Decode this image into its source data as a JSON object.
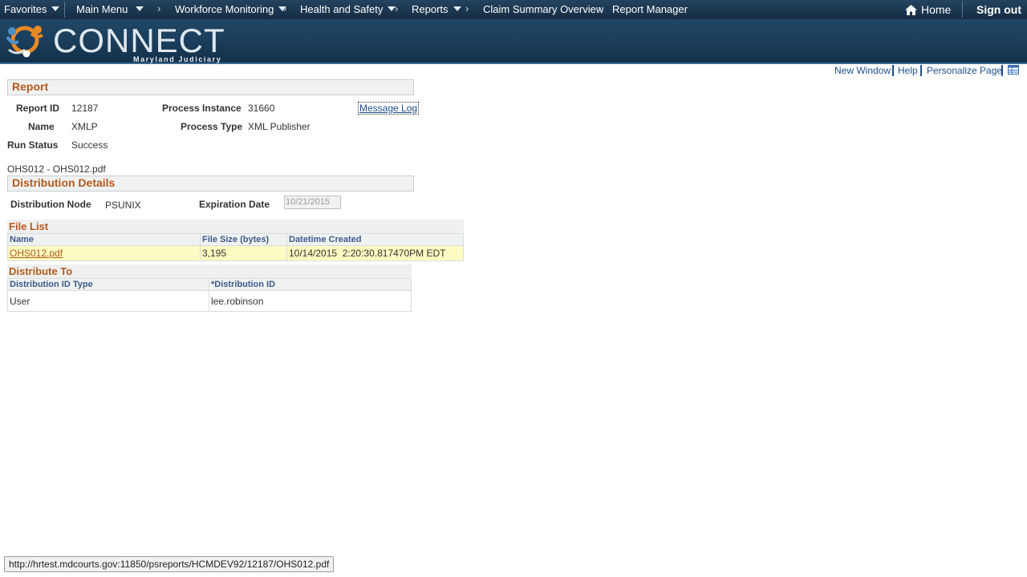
{
  "nav": {
    "favorites": "Favorites",
    "main_menu": "Main Menu",
    "breadcrumb": [
      "Workforce Monitoring",
      "Health and Safety",
      "Reports",
      "Claim Summary Overview",
      "Report Manager"
    ],
    "home": "Home",
    "sign_out": "Sign out"
  },
  "banner": {
    "brand": "CONNECT",
    "subtitle": "Maryland Judiciary"
  },
  "pagebar": {
    "new_window": "New Window",
    "help": "Help",
    "personalize": "Personalize Page"
  },
  "report": {
    "section_title": "Report",
    "report_id_label": "Report ID",
    "report_id": "12187",
    "process_instance_label": "Process Instance",
    "process_instance": "31660",
    "message_log": "Message Log",
    "name_label": "Name",
    "name": "XMLP",
    "process_type_label": "Process Type",
    "process_type": "XML Publisher",
    "run_status_label": "Run Status",
    "run_status": "Success"
  },
  "report_title": "OHS012 - OHS012.pdf",
  "distribution": {
    "section_title": "Distribution Details",
    "node_label": "Distribution Node",
    "node": "PSUNIX",
    "expiration_label": "Expiration Date",
    "expiration": "10/21/2015"
  },
  "file_list": {
    "title": "File List",
    "columns": [
      "Name",
      "File Size (bytes)",
      "Datetime Created"
    ],
    "rows": [
      {
        "name": "OHS012.pdf",
        "size": "3,195",
        "created": "10/14/2015  2:20:30.817470PM EDT"
      }
    ]
  },
  "distribute_to": {
    "title": "Distribute To",
    "columns": [
      "Distribution ID Type",
      "*Distribution ID"
    ],
    "rows": [
      {
        "type": "User",
        "id": "lee.robinson"
      }
    ]
  },
  "status_bar": "http://hrtest.mdcourts.gov:11850/psreports/HCMDEV92/12187/OHS012.pdf",
  "colors": {
    "nav_bg": "#1c3a55",
    "section_title": "#b55a1c",
    "link": "#1d4f8b",
    "row_highlight": "#fbfbc2"
  }
}
